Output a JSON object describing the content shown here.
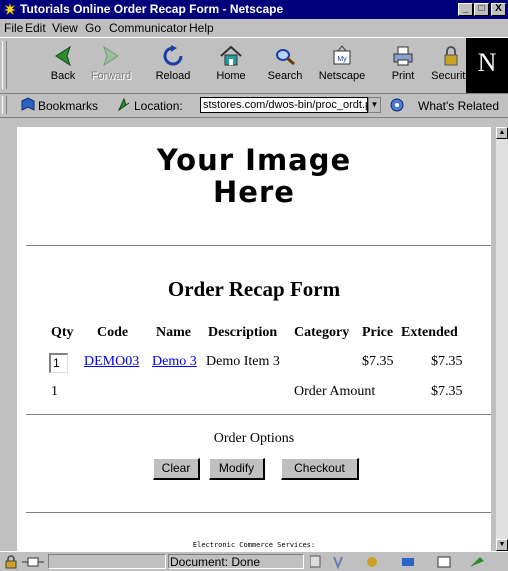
{
  "window": {
    "title": "Tutorials Online Order Recap Form - Netscape",
    "controls": [
      "_",
      "□",
      "X"
    ]
  },
  "menu": [
    "File",
    "Edit",
    "View",
    "Go",
    "Communicator",
    "Help"
  ],
  "toolbar": {
    "buttons": [
      {
        "label": "Back",
        "icon": "back-arrow-icon",
        "enabled": true
      },
      {
        "label": "Forward",
        "icon": "forward-arrow-icon",
        "enabled": false
      },
      {
        "label": "Reload",
        "icon": "reload-icon",
        "enabled": true
      },
      {
        "label": "Home",
        "icon": "home-icon",
        "enabled": true
      },
      {
        "label": "Search",
        "icon": "search-icon",
        "enabled": true
      },
      {
        "label": "Netscape",
        "icon": "netscape-icon",
        "enabled": true
      },
      {
        "label": "Print",
        "icon": "print-icon",
        "enabled": true
      },
      {
        "label": "Security",
        "icon": "security-lock-icon",
        "enabled": true
      }
    ],
    "logo": "N"
  },
  "location": {
    "bookmarks_label": "Bookmarks",
    "location_label": "Location:",
    "url": "ststores.com/dwos-bin/proc_ordt.pl",
    "related_label": "What's Related"
  },
  "page": {
    "image_placeholder_line1": "Your Image",
    "image_placeholder_line2": "Here",
    "form_title": "Order Recap Form",
    "table": {
      "headers": [
        "Qty",
        "Code",
        "Name",
        "Description",
        "Category",
        "Price",
        "Extended"
      ],
      "row": {
        "qty": "1",
        "code": "DEMO03",
        "name": "Demo 3",
        "description": "Demo Item 3",
        "category": "",
        "price": "$7.35",
        "extended": "$7.35"
      },
      "total": {
        "count": "1",
        "label": "Order Amount",
        "amount": "$7.35"
      }
    },
    "options_label": "Order Options",
    "buttons": {
      "clear": "Clear",
      "modify": "Modify",
      "checkout": "Checkout"
    },
    "footer": "Electronic Commerce Services:"
  },
  "status": {
    "text": "Document: Done"
  }
}
